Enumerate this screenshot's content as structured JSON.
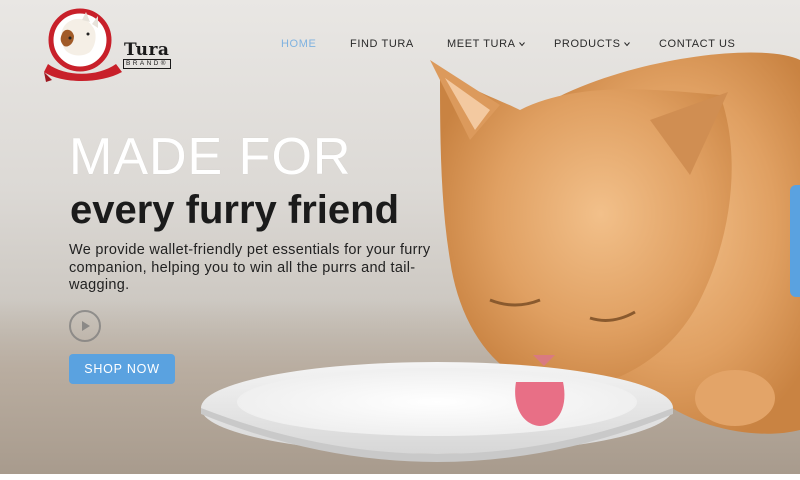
{
  "brand": {
    "name": "Tura",
    "sub": "BRAND",
    "registered": "®"
  },
  "nav": {
    "items": [
      {
        "label": "HOME",
        "active": true,
        "dropdown": false
      },
      {
        "label": "FIND TURA",
        "active": false,
        "dropdown": false
      },
      {
        "label": "MEET TURA",
        "active": false,
        "dropdown": true
      },
      {
        "label": "PRODUCTS",
        "active": false,
        "dropdown": true
      },
      {
        "label": "CONTACT US",
        "active": false,
        "dropdown": false
      }
    ]
  },
  "hero": {
    "headline_1": "MADE FOR",
    "headline_2": "every furry friend",
    "subtext": "We provide wallet-friendly pet essentials for your furry companion, helping you to win all the purrs and tail-wagging.",
    "cta_label": "SHOP NOW",
    "play_icon": "play-icon",
    "image": "kitten-drinking-milk"
  },
  "colors": {
    "accent": "#5aa2e0",
    "nav_active": "#7fb2e0",
    "logo_red": "#c8202a",
    "kitten": "#e2a15f"
  }
}
